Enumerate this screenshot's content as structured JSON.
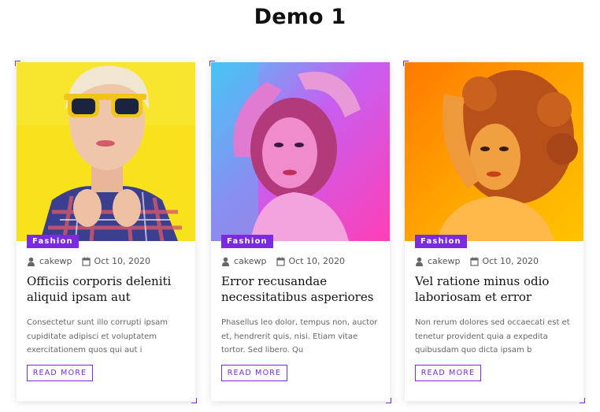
{
  "page": {
    "title": "Demo 1"
  },
  "accent": "#7b2ae0",
  "cards": [
    {
      "category": "Fashion",
      "author": "cakewp",
      "date": "Oct 10, 2020",
      "title": "Officiis corporis deleniti aliquid ipsam aut",
      "excerpt": "Consectetur sunt illo corrupti ipsam cupiditate adipisci et voluptatem exercitationem quos qui aut i",
      "button": "READ MORE",
      "image": "woman-yellow-sunglasses-plaid-shirt"
    },
    {
      "category": "Fashion",
      "author": "cakewp",
      "date": "Oct 10, 2020",
      "title": "Error recusandae necessitatibus asperiores",
      "excerpt": "Phasellus leo dolor, tempus non, auctor et, hendrerit quis, nisi. Etiam vitae tortor. Sed libero. Qu",
      "button": "READ MORE",
      "image": "woman-pink-neon-light"
    },
    {
      "category": "Fashion",
      "author": "cakewp",
      "date": "Oct 10, 2020",
      "title": "Vel ratione minus odio laboriosam et error",
      "excerpt": "Non rerum dolores sed occaecati est et tenetur provident quia a expedita quibusdam quo dicta ipsam b",
      "button": "READ MORE",
      "image": "woman-orange-curly-hair"
    }
  ]
}
